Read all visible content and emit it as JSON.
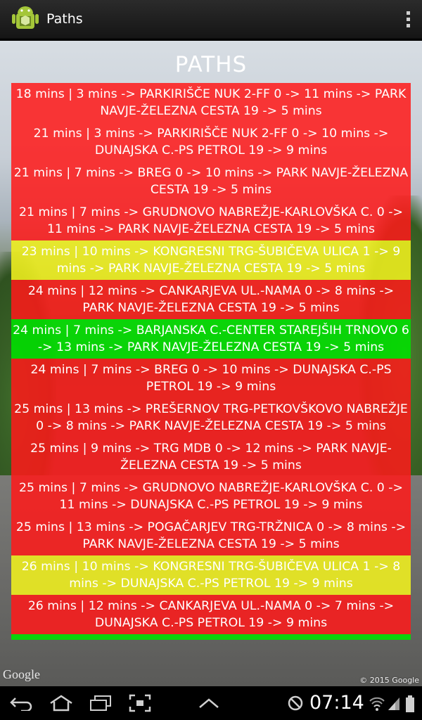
{
  "app": {
    "title": "Paths",
    "page_title": "PATHS",
    "icon": "android-robot-icon",
    "menu_icon": "overflow-menu-icon"
  },
  "paths": [
    {
      "text": "18 mins | 3 mins -> PARKIRIŠČE NUK 2-FF 0 -> 11 mins -> PARK NAVJE-ŽELEZNA CESTA 19 -> 5 mins",
      "color": "red"
    },
    {
      "text": "21 mins | 3 mins -> PARKIRIŠČE NUK 2-FF 0 -> 10 mins -> DUNAJSKA C.-PS PETROL 19 -> 9 mins",
      "color": "red"
    },
    {
      "text": "21 mins | 7 mins -> BREG 0 -> 10 mins -> PARK NAVJE-ŽELEZNA CESTA 19 -> 5 mins",
      "color": "red"
    },
    {
      "text": "21 mins | 7 mins -> GRUDNOVO NABREŽJE-KARLOVŠKA C. 0 -> 11 mins -> PARK NAVJE-ŽELEZNA CESTA 19 -> 5 mins",
      "color": "red"
    },
    {
      "text": "23 mins | 10 mins -> KONGRESNI TRG-ŠUBIČEVA ULICA 1 -> 9 mins -> PARK NAVJE-ŽELEZNA CESTA 19 -> 5 mins",
      "color": "yellow"
    },
    {
      "text": "24 mins | 12 mins -> CANKARJEVA UL.-NAMA 0 -> 8 mins -> PARK NAVJE-ŽELEZNA CESTA 19 -> 5 mins",
      "color": "red"
    },
    {
      "text": "24 mins | 7 mins -> BARJANSKA C.-CENTER STAREJŠIH TRNOVO 6 -> 13 mins -> PARK NAVJE-ŽELEZNA CESTA 19 -> 5 mins",
      "color": "green"
    },
    {
      "text": "24 mins | 7 mins -> BREG 0 -> 10 mins -> DUNAJSKA C.-PS PETROL 19 -> 9 mins",
      "color": "red"
    },
    {
      "text": "25 mins | 13 mins -> PREŠERNOV TRG-PETKOVŠKOVO NABREŽJE 0 -> 8 mins -> PARK NAVJE-ŽELEZNA CESTA 19 -> 5 mins",
      "color": "red"
    },
    {
      "text": "25 mins | 9 mins -> TRG MDB 0 -> 12 mins -> PARK NAVJE-ŽELEZNA CESTA 19 -> 5 mins",
      "color": "red"
    },
    {
      "text": "25 mins | 7 mins -> GRUDNOVO NABREŽJE-KARLOVŠKA C. 0 -> 11 mins -> DUNAJSKA C.-PS PETROL 19 -> 9 mins",
      "color": "red"
    },
    {
      "text": "25 mins | 13 mins -> POGAČARJEV TRG-TRŽNICA 0 -> 8 mins -> PARK NAVJE-ŽELEZNA CESTA 19 -> 5 mins",
      "color": "red"
    },
    {
      "text": "26 mins | 10 mins -> KONGRESNI TRG-ŠUBIČEVA ULICA 1 -> 8 mins -> DUNAJSKA C.-PS PETROL 19 -> 9 mins",
      "color": "yellow"
    },
    {
      "text": "26 mins | 12 mins -> CANKARJEVA UL.-NAMA 0 -> 7 mins -> DUNAJSKA C.-PS PETROL 19 -> 9 mins",
      "color": "red"
    },
    {
      "text": "",
      "color": "green"
    }
  ],
  "map": {
    "logo": "Google",
    "copyright": "© 2015 Google"
  },
  "status_bar": {
    "time": "07:14"
  },
  "colors": {
    "red": "#ff1a1a",
    "yellow": "#f0f01e",
    "green": "#00e100"
  }
}
